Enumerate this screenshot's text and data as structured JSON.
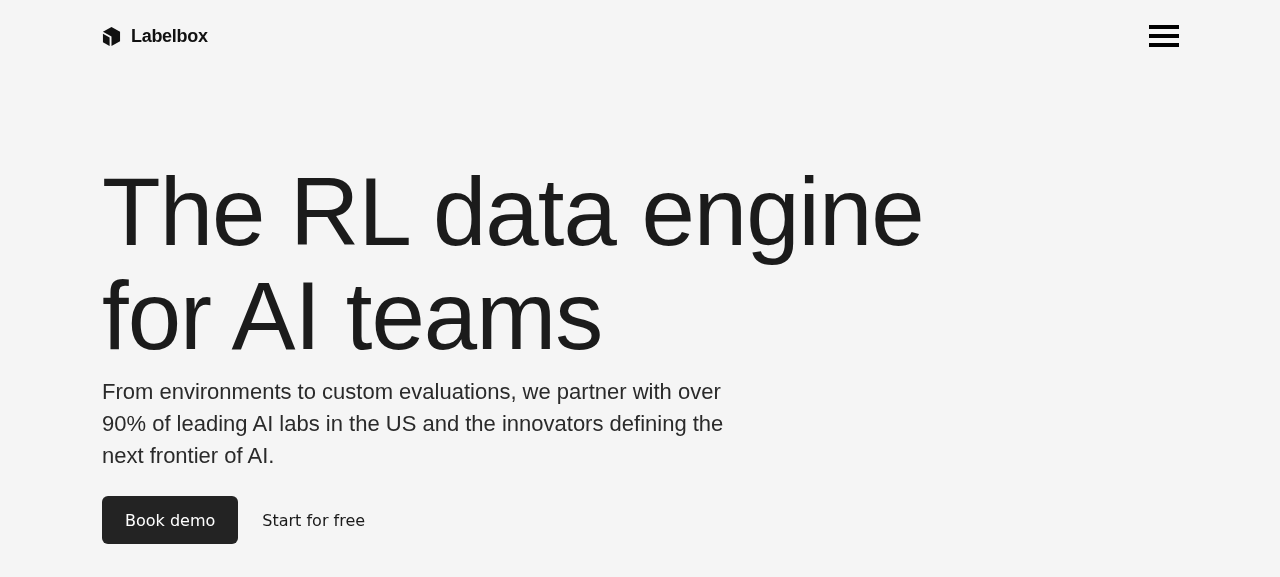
{
  "header": {
    "logo_text": "Labelbox"
  },
  "hero": {
    "headline_lines": [
      "The RL data engine",
      "for AI teams"
    ],
    "subtitle": "From environments to custom evaluations, we partner with over 90% of leading AI labs in the US and the innovators defining the next frontier of AI.",
    "buttons": [
      {
        "label": "Book demo",
        "kind": "primary"
      },
      {
        "label": "Start for free",
        "kind": "link"
      }
    ]
  }
}
